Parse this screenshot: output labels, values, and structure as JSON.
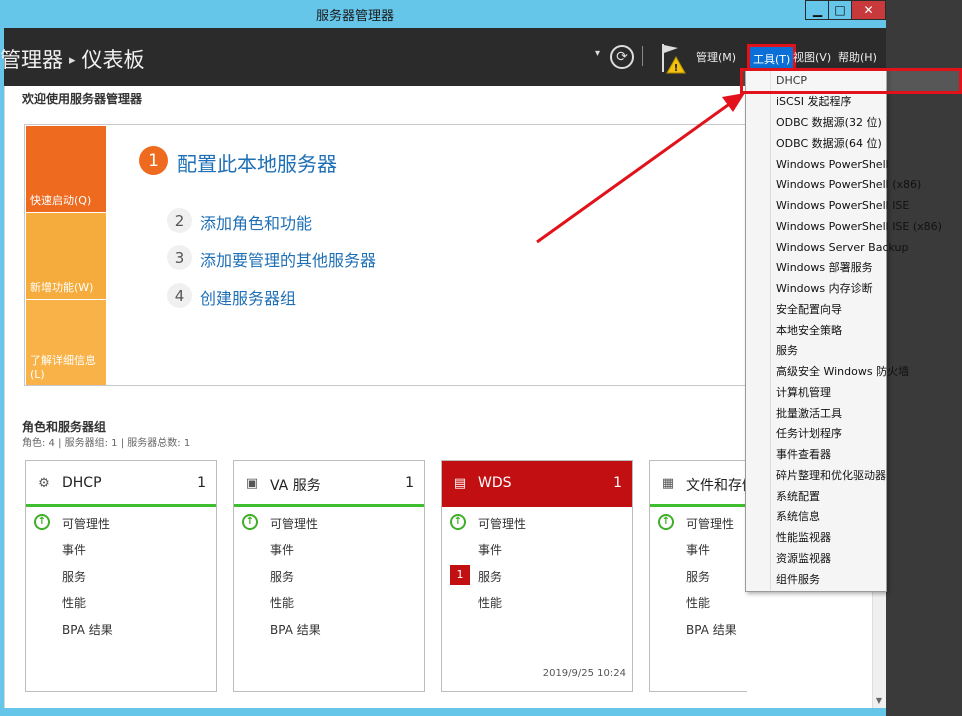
{
  "window": {
    "title": "服务器管理器"
  },
  "header": {
    "breadcrumb_parent": "管理器",
    "breadcrumb_sep": "▸",
    "breadcrumb_current": "仪表板",
    "menu": {
      "manage": "管理(M)",
      "tools": "工具(T)",
      "view": "视图(V)",
      "help": "帮助(H)"
    }
  },
  "welcome": {
    "heading": "欢迎使用服务器管理器",
    "tiles": {
      "quick": "快速启动(Q)",
      "new": "新增功能(W)",
      "learn": "了解详细信息(L)"
    },
    "steps": [
      {
        "num": "1",
        "label": "配置此本地服务器"
      },
      {
        "num": "2",
        "label": "添加角色和功能"
      },
      {
        "num": "3",
        "label": "添加要管理的其他服务器"
      },
      {
        "num": "4",
        "label": "创建服务器组"
      }
    ]
  },
  "roles": {
    "heading": "角色和服务器组",
    "summary": "角色: 4 | 服务器组: 1 | 服务器总数: 1",
    "cards": [
      {
        "title": "DHCP",
        "count": "1",
        "rows": [
          "可管理性",
          "事件",
          "服务",
          "性能",
          "BPA 结果"
        ],
        "icon": "dhcp-icon"
      },
      {
        "title": "VA 服务",
        "count": "1",
        "rows": [
          "可管理性",
          "事件",
          "服务",
          "性能",
          "BPA 结果"
        ],
        "icon": "va-icon"
      },
      {
        "title": "WDS",
        "count": "1",
        "rows": [
          "可管理性",
          "事件",
          "服务",
          "性能"
        ],
        "badge": "1",
        "time": "2019/9/25 10:24",
        "icon": "wds-icon"
      },
      {
        "title": "文件和存储",
        "count": "",
        "rows": [
          "可管理性",
          "事件",
          "服务",
          "性能",
          "BPA 结果"
        ],
        "icon": "file-storage-icon"
      }
    ]
  },
  "tools_menu": {
    "items": [
      "DHCP",
      "iSCSI 发起程序",
      "ODBC 数据源(32 位)",
      "ODBC 数据源(64 位)",
      "Windows PowerShell",
      "Windows PowerShell (x86)",
      "Windows PowerShell ISE",
      "Windows PowerShell ISE (x86)",
      "Windows Server Backup",
      "Windows 部署服务",
      "Windows 内存诊断",
      "安全配置向导",
      "本地安全策略",
      "服务",
      "高级安全 Windows 防火墙",
      "计算机管理",
      "批量激活工具",
      "任务计划程序",
      "事件查看器",
      "碎片整理和优化驱动器",
      "系统配置",
      "系统信息",
      "性能监视器",
      "资源监视器",
      "组件服务"
    ]
  },
  "colors": {
    "accent_orange": "#ee6a1f",
    "link_blue": "#1e6fb6",
    "status_green": "#3fbe2f",
    "alert_red": "#c20f12",
    "annotation_red": "#e1121a"
  }
}
